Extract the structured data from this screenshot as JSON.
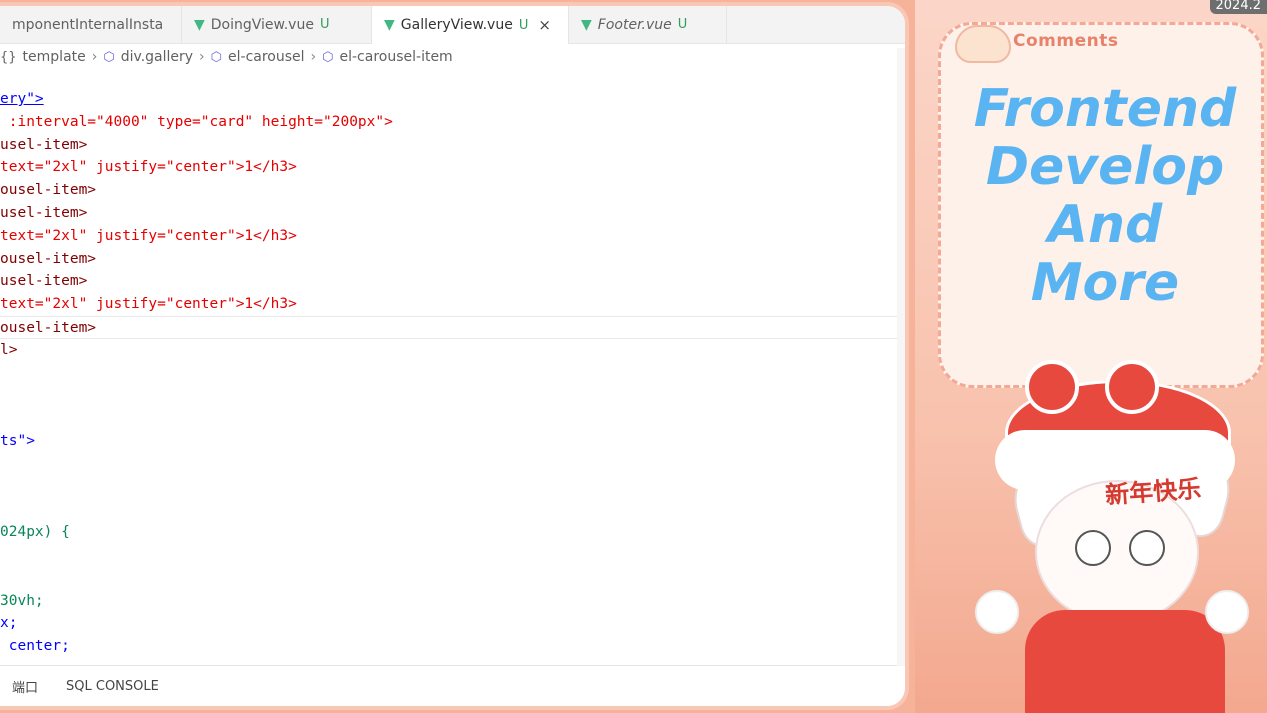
{
  "tabs": [
    {
      "label": "mponentInternalInsta",
      "icon": "",
      "badge": "",
      "active": false,
      "italic": false
    },
    {
      "label": "DoingView.vue",
      "icon": "vue-icon",
      "badge": "U",
      "active": false,
      "italic": false
    },
    {
      "label": "GalleryView.vue",
      "icon": "vue-icon",
      "badge": "U",
      "active": true,
      "italic": false,
      "close": "×"
    },
    {
      "label": "Footer.vue",
      "icon": "vue-icon",
      "badge": "U",
      "active": false,
      "italic": true
    }
  ],
  "breadcrumb": [
    {
      "label": "template",
      "icon": "{}"
    },
    {
      "label": "div.gallery",
      "icon": "cube-icon"
    },
    {
      "label": "el-carousel",
      "icon": "cube-icon"
    },
    {
      "label": "el-carousel-item",
      "icon": "cube-icon"
    }
  ],
  "code_lines": [
    "ery\">",
    " :interval=\"4000\" type=\"card\" height=\"200px\">",
    "usel-item>",
    "text=\"2xl\" justify=\"center\">1</h3>",
    "ousel-item>",
    "usel-item>",
    "text=\"2xl\" justify=\"center\">1</h3>",
    "ousel-item>",
    "usel-item>",
    "text=\"2xl\" justify=\"center\">1</h3>",
    "ousel-item>",
    "l>",
    "",
    "",
    "",
    "ts\">",
    "",
    "",
    "",
    "024px) {",
    "",
    "",
    "30vh;",
    "x;",
    " center;"
  ],
  "panel": {
    "ports_label": "端口",
    "sql_console_label": "SQL CONSOLE"
  },
  "overlay": {
    "comments_label": "Comments",
    "date_chip": "2024.2",
    "headline": [
      "Frontend",
      "Develop",
      "And",
      "More"
    ],
    "banner_text": "新年快乐"
  },
  "colors": {
    "vue_green": "#41b883",
    "headline_blue": "#5ab4f2",
    "overlay_pink": "#f8c2ad"
  }
}
